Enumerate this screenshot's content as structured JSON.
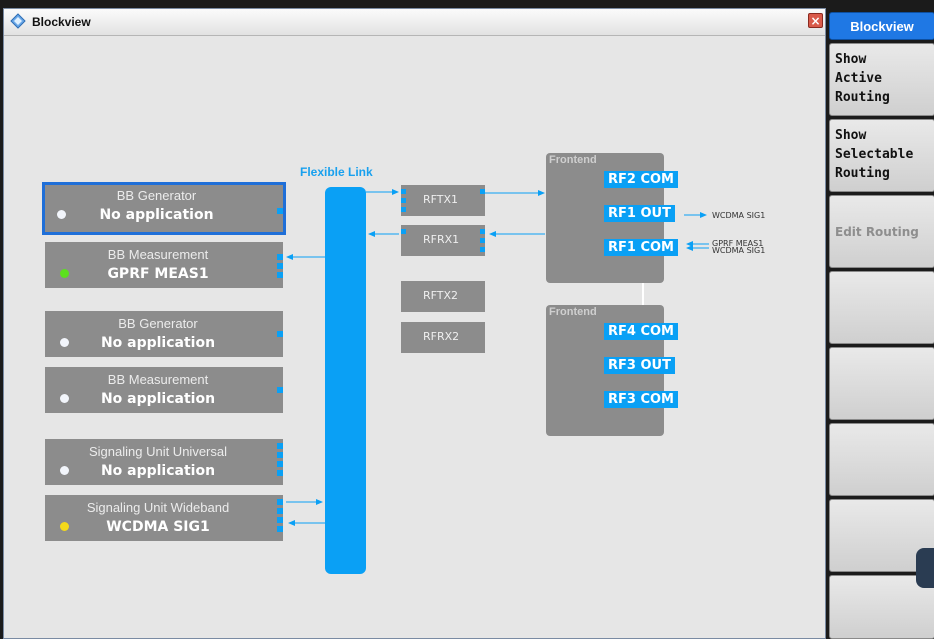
{
  "window": {
    "title": "Blockview",
    "close_symbol": "×"
  },
  "diagram": {
    "flexible_link_label": "Flexible Link",
    "blocks": [
      {
        "title": "BB Generator",
        "value": "No application",
        "led": "white",
        "selected": true
      },
      {
        "title": "BB Measurement",
        "value": "GPRF MEAS1",
        "led": "green",
        "selected": false
      },
      {
        "title": "BB Generator",
        "value": "No application",
        "led": "white",
        "selected": false
      },
      {
        "title": "BB Measurement",
        "value": "No application",
        "led": "white",
        "selected": false
      },
      {
        "title": "Signaling Unit Universal",
        "value": "No application",
        "led": "white",
        "selected": false
      },
      {
        "title": "Signaling Unit Wideband",
        "value": "WCDMA SIG1",
        "led": "yellow",
        "selected": false
      }
    ],
    "rf_boxes": [
      "RFTX1",
      "RFRX1",
      "RFTX2",
      "RFRX2"
    ],
    "frontends": [
      {
        "label": "Frontend",
        "connectors": [
          "RF2 COM",
          "RF1 OUT",
          "RF1 COM"
        ]
      },
      {
        "label": "Frontend",
        "connectors": [
          "RF4 COM",
          "RF3 OUT",
          "RF3 COM"
        ]
      }
    ],
    "routing_labels": {
      "rf1_out": "WCDMA SIG1",
      "rf1_com_1": "GPRF MEAS1",
      "rf1_com_2": "WCDMA SIG1"
    }
  },
  "softkeys": {
    "header": "Blockview",
    "items": [
      {
        "label": "Show\nActive\nRouting",
        "enabled": true
      },
      {
        "label": "Show\nSelectable\nRouting",
        "enabled": true
      },
      {
        "label": "Edit Routing",
        "enabled": false
      },
      {
        "label": "",
        "enabled": false
      },
      {
        "label": "",
        "enabled": false
      },
      {
        "label": "",
        "enabled": false
      },
      {
        "label": "",
        "enabled": false
      },
      {
        "label": "",
        "enabled": false
      }
    ]
  },
  "colors": {
    "accent": "#0aa0f5",
    "selected_border": "#1f6fd8",
    "block_gray": "#8c8c8c",
    "background": "#e6e6e6"
  }
}
